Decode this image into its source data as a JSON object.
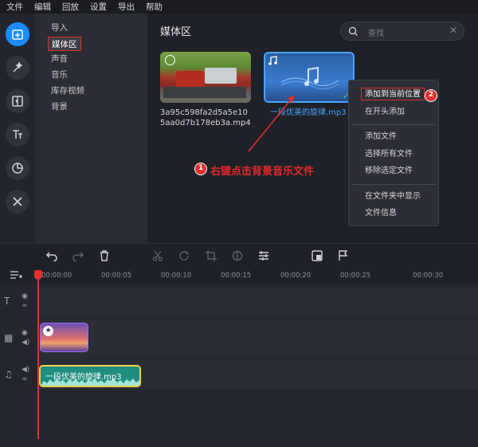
{
  "menu": [
    "文件",
    "编辑",
    "回放",
    "设置",
    "导出",
    "帮助"
  ],
  "nav": [
    "导入",
    "媒体区",
    "声音",
    "音乐",
    "库存视频",
    "背景"
  ],
  "media": {
    "title": "媒体区",
    "search_placeholder": "查找",
    "file1_line1": "3a95c598fa2d5a5e10",
    "file1_line2": "5aa0d7b178eb3a.mp4",
    "file2": "一段优美的旋律.mp3"
  },
  "context_menu": {
    "add_here": "添加到当前位置",
    "add_start": "在开头添加",
    "add_file": "添加文件",
    "select_all": "选择所有文件",
    "remove_selected": "移除选定文件",
    "show_in_folder": "在文件夹中显示",
    "file_info": "文件信息"
  },
  "annotation": {
    "step1_badge": "1",
    "step1_text": "右键点击背景音乐文件",
    "step2_badge": "2"
  },
  "timeline": {
    "ticks": [
      "00:00:00",
      "00:00:05",
      "00:00:10",
      "00:00:15",
      "00:00:20",
      "00:00:25",
      "00:00:30"
    ],
    "audio_clip": "一段优美的旋律.mp3"
  },
  "colors": {
    "accent": "#1a8cff",
    "annotation": "#e03030",
    "audio_clip": "#1f8e80"
  }
}
